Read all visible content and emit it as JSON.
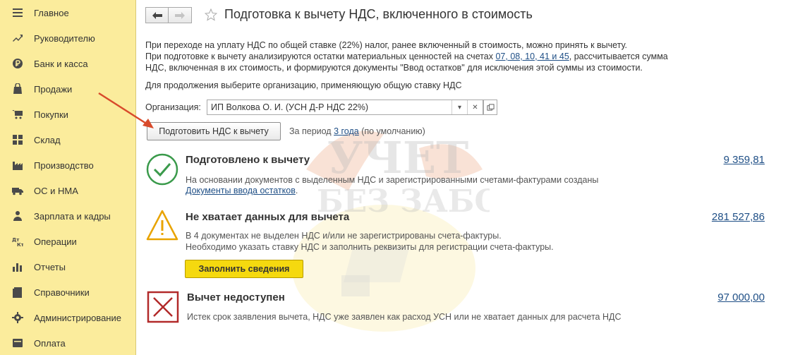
{
  "sidebar": {
    "items": [
      {
        "label": "Главное",
        "icon": "menu-icon"
      },
      {
        "label": "Руководителю",
        "icon": "trend-icon"
      },
      {
        "label": "Банк и касса",
        "icon": "ruble-icon"
      },
      {
        "label": "Продажи",
        "icon": "bag-icon"
      },
      {
        "label": "Покупки",
        "icon": "cart-icon"
      },
      {
        "label": "Склад",
        "icon": "warehouse-icon"
      },
      {
        "label": "Производство",
        "icon": "factory-icon"
      },
      {
        "label": "ОС и НМА",
        "icon": "truck-icon"
      },
      {
        "label": "Зарплата и кадры",
        "icon": "people-icon"
      },
      {
        "label": "Операции",
        "icon": "dt-kt-icon"
      },
      {
        "label": "Отчеты",
        "icon": "bar-chart-icon"
      },
      {
        "label": "Справочники",
        "icon": "book-icon"
      },
      {
        "label": "Администрирование",
        "icon": "gear-icon"
      },
      {
        "label": "Оплата",
        "icon": "card-icon"
      }
    ],
    "bg_color": "#fbec9c"
  },
  "header": {
    "title": "Подготовка к вычету НДС, включенного в стоимость"
  },
  "description": {
    "line1": "При переходе на уплату НДС по общей ставке (22%) налог, ранее включенный в стоимость, можно принять к вычету.",
    "line2_prefix": "При подготовке к вычету анализируются остатки материальных ценностей на счетах ",
    "accounts_link": "07, 08, 10, 41 и 45",
    "line2_suffix": ", рассчитывается сумма",
    "line3": "НДС, включенная в их стоимость, и формируются документы \"Ввод остатков\" для исключения этой суммы из стоимости."
  },
  "hint": "Для продолжения выберите организацию, применяющую общую ставку НДС",
  "organization": {
    "label": "Организация:",
    "value": "ИП Волкова О. И. (УСН Д-Р НДС 22%)"
  },
  "prepare_button": "Подготовить НДС к вычету",
  "period": {
    "prefix": "За период ",
    "link": "3 года",
    "suffix": " (по умолчанию)"
  },
  "sections": {
    "ready": {
      "title": "Подготовлено к вычету",
      "text": "На основании документов с выделенным НДС и зарегистрированными счетами-фактурами созданы",
      "link": "Документы ввода остатков",
      "link_suffix": ".",
      "amount": "9 359,81",
      "color": "#3a9a4b"
    },
    "missing": {
      "title": "Не хватает данных для вычета",
      "text1": "В 4 документах не выделен НДС и/или не зарегистрированы счета-фактуры.",
      "text2": "Необходимо указать ставку НДС и заполнить реквизиты для регистрации счета-фактуры.",
      "button": "Заполнить сведения",
      "amount": "281 527,86",
      "color": "#e8a300"
    },
    "unavailable": {
      "title": "Вычет недоступен",
      "text": "Истек срок заявления вычета, НДС уже заявлен как расход УСН или не хватает данных для расчета НДС",
      "amount": "97 000,00",
      "color": "#b22a2a"
    }
  },
  "colors": {
    "link": "#1f4f86",
    "button_yellow": "#f5d90f",
    "arrow": "#d84a2b"
  },
  "watermark": {
    "line1": "УЧЕТ",
    "line2": "БЕЗ ЗАБОТ"
  }
}
